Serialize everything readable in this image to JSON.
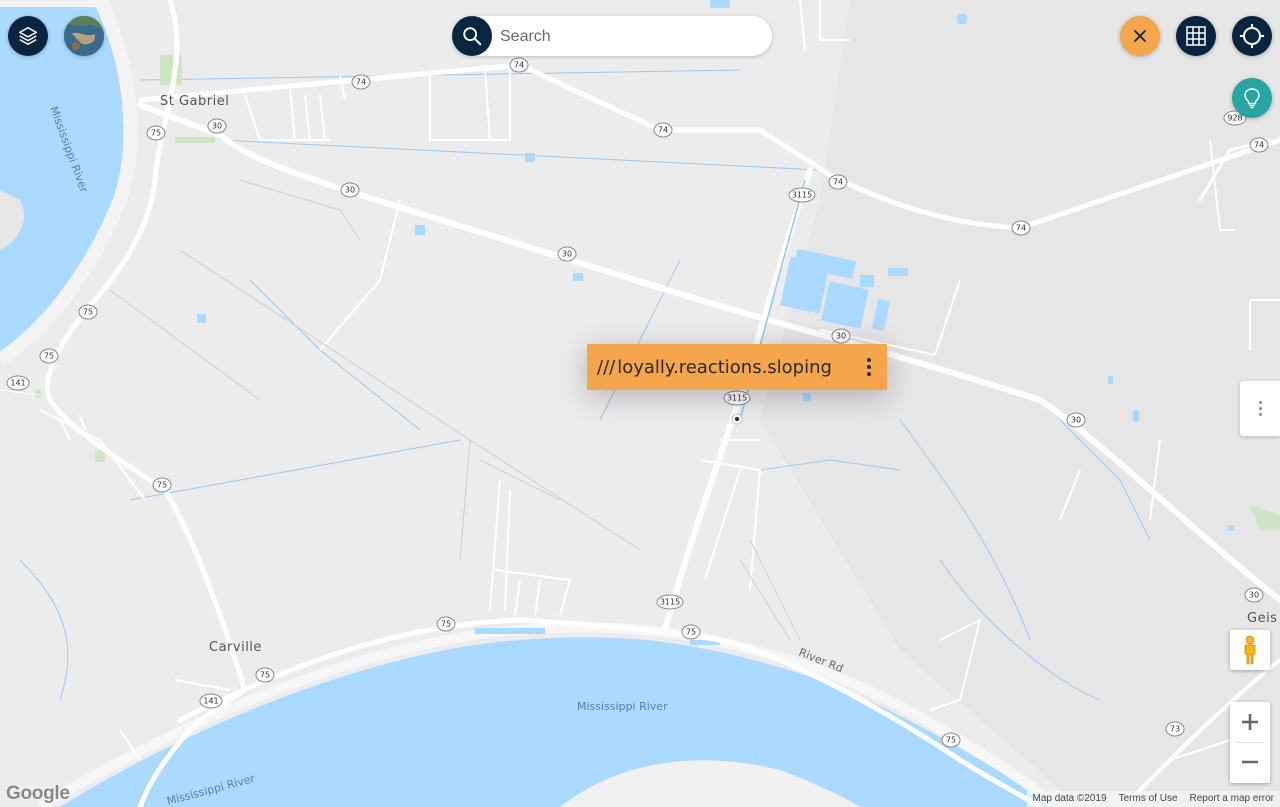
{
  "search": {
    "placeholder": "Search"
  },
  "popup": {
    "prefix": "///",
    "words": "loyally.reactions.sloping"
  },
  "places": {
    "st_gabriel": "St Gabriel",
    "carville": "Carville",
    "geis": "Geis"
  },
  "water": {
    "river_left": "Mississippi River",
    "river_bottom": "Mississippi River",
    "river_bottom_left": "Mississippi River"
  },
  "roads": {
    "river_rd": "River Rd"
  },
  "shields": [
    "74",
    "30",
    "75",
    "141",
    "3115",
    "928",
    "73"
  ],
  "attribution": {
    "map_data": "Map data ©2019",
    "terms": "Terms of Use",
    "report": "Report a map error"
  },
  "logo": "Google",
  "icons": {
    "layers": "layers-icon",
    "satellite": "satellite-thumbnail-icon",
    "search": "search-icon",
    "close": "close-icon",
    "grid": "grid-icon",
    "locate": "crosshair-icon",
    "tip": "lightbulb-icon",
    "pegman": "pegman-icon",
    "zoom_in": "plus-icon",
    "zoom_out": "minus-icon"
  },
  "colors": {
    "dark_button": "#0a2540",
    "close_button": "#f5a54b",
    "tip_button": "#26a5a2",
    "popup": "#f5a54b",
    "water": "#aadaff",
    "land": "#ececec"
  }
}
